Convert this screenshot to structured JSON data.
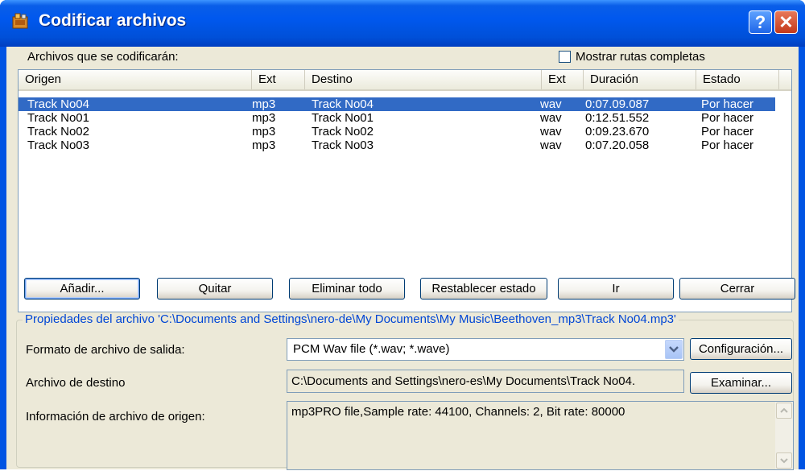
{
  "window": {
    "title": "Codificar archivos",
    "help_glyph": "?",
    "close_glyph": "✕",
    "icon": "nero-app-icon"
  },
  "files_label": "Archivos que se codificarán:",
  "show_full_paths": {
    "label": "Mostrar rutas completas",
    "checked": false
  },
  "table": {
    "columns": [
      "Origen",
      "Ext",
      "Destino",
      "Ext",
      "Duración",
      "Estado"
    ],
    "rows": [
      {
        "origin": "Track No04",
        "ext": "mp3",
        "dest": "Track No04",
        "dext": "wav",
        "duration": "0:07.09.087",
        "status": "Por hacer",
        "selected": true
      },
      {
        "origin": "Track No01",
        "ext": "mp3",
        "dest": "Track No01",
        "dext": "wav",
        "duration": "0:12.51.552",
        "status": "Por hacer",
        "selected": false
      },
      {
        "origin": "Track No02",
        "ext": "mp3",
        "dest": "Track No02",
        "dext": "wav",
        "duration": "0:09.23.670",
        "status": "Por hacer",
        "selected": false
      },
      {
        "origin": "Track No03",
        "ext": "mp3",
        "dest": "Track No03",
        "dext": "wav",
        "duration": "0:07.20.058",
        "status": "Por hacer",
        "selected": false
      }
    ]
  },
  "buttons": {
    "add": "Añadir...",
    "remove": "Quitar",
    "remove_all": "Eliminar todo",
    "reset_status": "Restablecer estado",
    "go": "Ir",
    "close": "Cerrar"
  },
  "properties": {
    "title": "Propiedades del archivo 'C:\\Documents and Settings\\nero-de\\My Documents\\My Music\\Beethoven_mp3\\Track No04.mp3'",
    "output_format_label": "Formato de archivo de salida:",
    "output_format_value": "PCM Wav file (*.wav; *.wave)",
    "config_button": "Configuración...",
    "dest_file_label": "Archivo de destino",
    "dest_file_value": "C:\\Documents and Settings\\nero-es\\My Documents\\Track No04.",
    "browse_button": "Examinar...",
    "source_info_label": "Información de archivo de origen:",
    "source_info_value": "mp3PRO file,Sample rate: 44100, Channels: 2, Bit rate: 80000"
  },
  "colors": {
    "titlebar": "#0054e3",
    "selection": "#316ac5",
    "dialog_bg": "#ece9d8",
    "group_title": "#0046d5"
  }
}
